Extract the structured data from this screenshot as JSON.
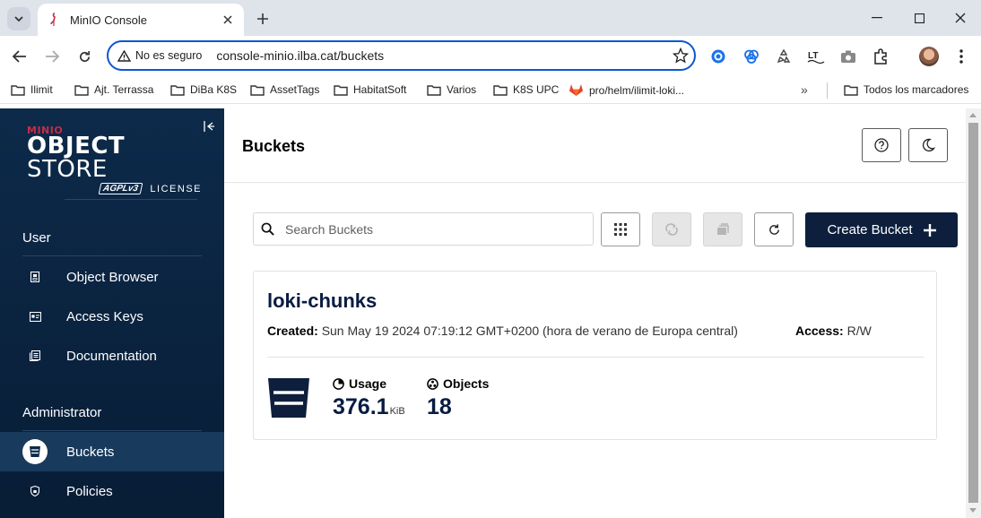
{
  "browser": {
    "tab_title": "MinIO Console",
    "security_label": "No es seguro",
    "url": "console-minio.ilba.cat/buckets",
    "bookmarks": [
      "Ilimit",
      "Ajt. Terrassa",
      "DiBa K8S",
      "AssetTags",
      "HabitatSoft",
      "Varios",
      "K8S UPC",
      "pro/helm/ilimit-loki...",
      "Todos los marcadores"
    ],
    "bookmarks_more": "»"
  },
  "sidebar": {
    "brand": "MINIO",
    "product_bold": "OBJECT",
    "product_light": " STORE",
    "license_badge": "AGPLv3",
    "license_text": "LICENSE",
    "sections": {
      "user": "User",
      "admin": "Administrator"
    },
    "user_items": [
      {
        "label": "Object Browser",
        "icon": "object-browser-icon"
      },
      {
        "label": "Access Keys",
        "icon": "access-keys-icon"
      },
      {
        "label": "Documentation",
        "icon": "documentation-icon"
      }
    ],
    "admin_items": [
      {
        "label": "Buckets",
        "icon": "bucket-icon",
        "active": true
      },
      {
        "label": "Policies",
        "icon": "policies-icon"
      }
    ]
  },
  "main": {
    "page_title": "Buckets",
    "search_placeholder": "Search Buckets",
    "create_label": "Create Bucket"
  },
  "bucket": {
    "name": "loki-chunks",
    "created_label": "Created:",
    "created_value": "Sun May 19 2024 07:19:12 GMT+0200 (hora de verano de Europa central)",
    "access_label": "Access:",
    "access_value": "R/W",
    "usage_label": "Usage",
    "usage_value": "376.1",
    "usage_unit": "KiB",
    "objects_label": "Objects",
    "objects_value": "18"
  },
  "colors": {
    "sidebar_bg": "#0d2a4a",
    "primary_button": "#0d1f3c",
    "brand_red": "#c72c48",
    "omnibox_border": "#0b57d0"
  }
}
